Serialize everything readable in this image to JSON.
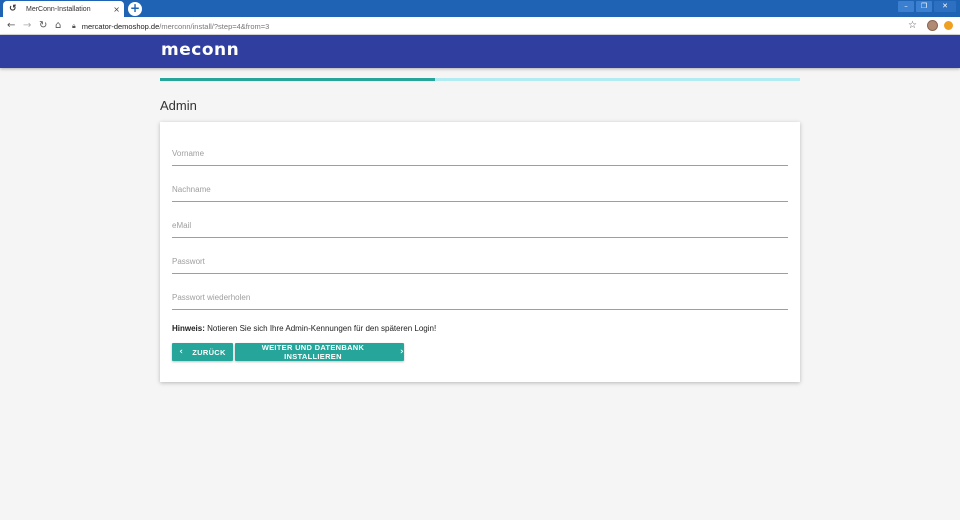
{
  "browser": {
    "tab_title": "MerConn-Installation",
    "tab_favicon": "mer-icon",
    "tab_close": "×",
    "new_tab": "+",
    "controls": {
      "minimize": "–",
      "restore": "❐",
      "close": "✕"
    },
    "url_host": "mercator-demoshop.de",
    "url_path": "/merconn/install/?step=4&from=3"
  },
  "app": {
    "logo": "meconn",
    "brand_color": "#303f9f",
    "accent_color": "#26a69a"
  },
  "progress": {
    "fraction": 0.43
  },
  "section": {
    "title": "Admin"
  },
  "form": {
    "fields": [
      {
        "placeholder": "Vorname",
        "value": ""
      },
      {
        "placeholder": "Nachname",
        "value": ""
      },
      {
        "placeholder": "eMail",
        "value": ""
      },
      {
        "placeholder": "Passwort",
        "value": ""
      },
      {
        "placeholder": "Passwort wiederholen",
        "value": ""
      }
    ],
    "hint_label": "Hinweis:",
    "hint_text": " Notieren Sie sich Ihre Admin-Kennungen für den späteren Login!",
    "back_label": "ZURÜCK",
    "next_label": "WEITER UND DATENBANK INSTALLIEREN"
  }
}
